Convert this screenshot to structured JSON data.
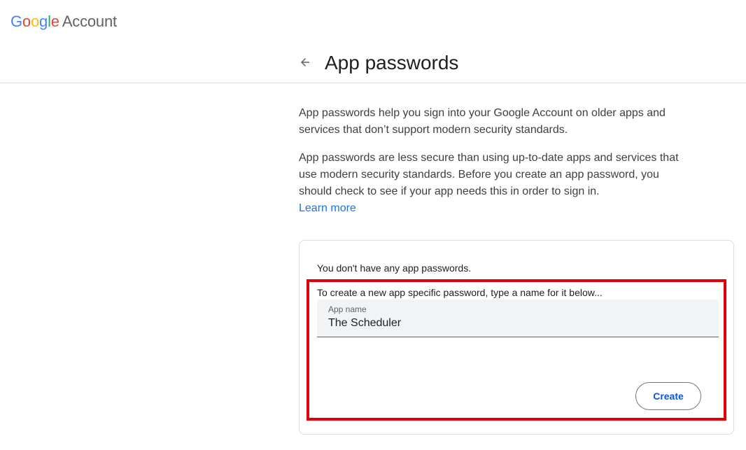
{
  "header": {
    "logo": {
      "letters": [
        "G",
        "o",
        "o",
        "g",
        "l",
        "e"
      ],
      "product": "Account"
    }
  },
  "titlebar": {
    "back_icon": "arrow-back-icon",
    "title": "App passwords"
  },
  "intro": {
    "paragraph1": "App passwords help you sign into your Google Account on older apps and services that don’t support modern security standards.",
    "paragraph2": "App passwords are less secure than using up-to-date apps and services that use modern security standards. Before you create an app password, you should check to see if your app needs this in order to sign in.",
    "learn_more": "Learn more"
  },
  "card": {
    "empty_message": "You don't have any app passwords.",
    "instruction": "To create a new app specific password, type a name for it below...",
    "field": {
      "label": "App name",
      "value": "The Scheduler"
    },
    "create_label": "Create"
  },
  "colors": {
    "google_blue": "#4285f4",
    "google_red": "#ea4335",
    "google_yellow": "#fbbc05",
    "google_green": "#34a853",
    "link": "#1a73e8",
    "button_text": "#0b57d0",
    "highlight_border": "#e0000a"
  }
}
